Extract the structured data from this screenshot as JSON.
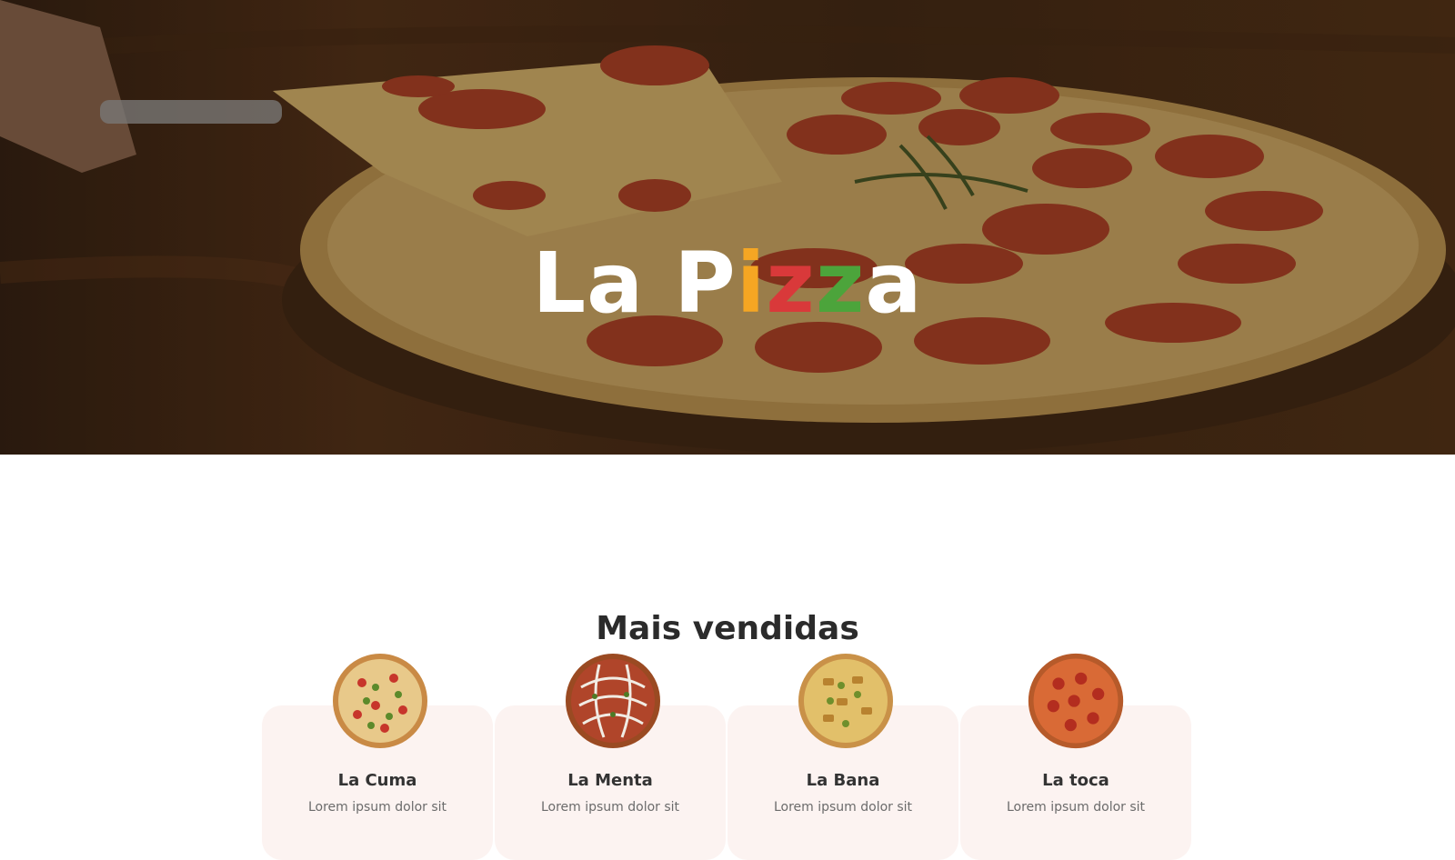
{
  "hero": {
    "brand_parts": [
      "La P",
      "i",
      "z",
      "z",
      "a"
    ]
  },
  "best_sellers": {
    "title": "Mais vendidas",
    "items": [
      {
        "name": "La Cuma",
        "description": "Lorem ipsum dolor sit"
      },
      {
        "name": "La Menta",
        "description": "Lorem ipsum dolor sit"
      },
      {
        "name": "La Bana",
        "description": "Lorem ipsum dolor sit"
      },
      {
        "name": "La toca",
        "description": "Lorem ipsum dolor sit"
      }
    ]
  },
  "colors": {
    "brand_yellow": "#f5a623",
    "brand_red": "#d9393a",
    "brand_green": "#4ca43b",
    "card_background": "#fcf3f1",
    "heading": "#2b2b2b"
  }
}
